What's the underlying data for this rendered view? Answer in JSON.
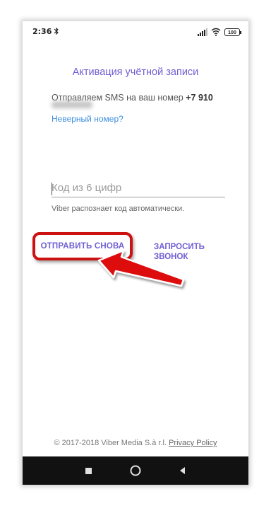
{
  "status_bar": {
    "time": "2:36",
    "battery": "100"
  },
  "screen": {
    "title": "Активация учётной записи",
    "sms_text": "Отправляем SMS на ваш номер ",
    "phone_prefix": "+7 910",
    "wrong_number_link": "Неверный номер?",
    "code_input": {
      "placeholder": "Код из 6 цифр",
      "value": ""
    },
    "auto_hint": "Viber распознает код автоматически.",
    "resend_button": "ОТПРАВИТЬ СНОВА",
    "call_button": "ЗАПРОСИТЬ ЗВОНОК",
    "footer_copyright": "© 2017-2018 Viber Media S.à r.l.",
    "footer_privacy": "Privacy Policy"
  },
  "annotation": {
    "highlight_color": "#cc1111"
  },
  "colors": {
    "accent": "#6f5ed3",
    "link": "#3d8fe0",
    "nav_bar": "#111111"
  },
  "icons": {
    "bluetooth": "bluetooth-icon",
    "signal": "signal-icon",
    "wifi": "wifi-icon",
    "battery": "battery-icon",
    "recent_apps": "recent-apps-icon",
    "home": "home-icon",
    "back": "back-icon",
    "pointer_arrow": "arrow-icon"
  }
}
